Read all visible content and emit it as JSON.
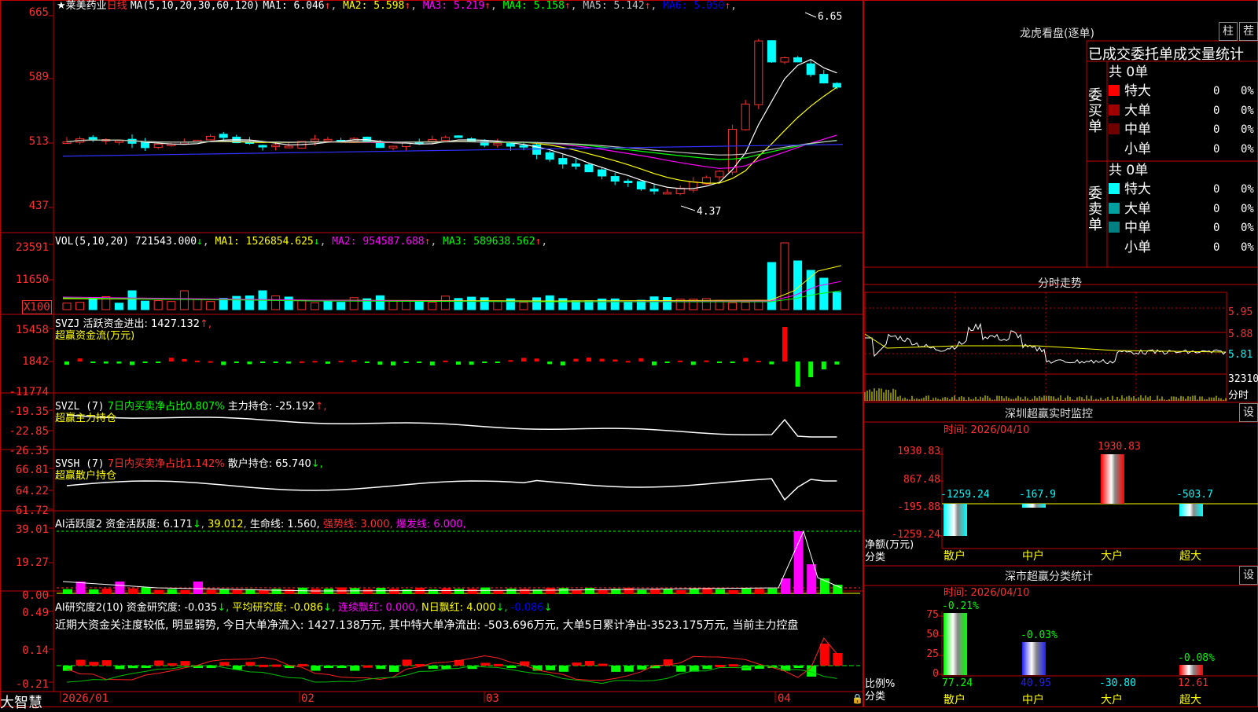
{
  "stock": {
    "star": "★",
    "name": "莱美药业",
    "period": "日线",
    "ma_params": "MA(5,10,20,30,60,120)",
    "ma_values": [
      {
        "label": "MA1: 6.046",
        "arrow": "↑",
        "color": "#ffffff"
      },
      {
        "label": "MA2: 5.598",
        "arrow": "↑",
        "color": "#ffff00"
      },
      {
        "label": "MA3: 5.219",
        "arrow": "↑",
        "color": "#ff00ff"
      },
      {
        "label": "MA4: 5.158",
        "arrow": "↑",
        "color": "#00ff00"
      },
      {
        "label": "MA5: 5.142",
        "arrow": "↑",
        "color": "#c0c0c0"
      },
      {
        "label": "MA6: 5.050",
        "arrow": "↑",
        "color": "#0000ff"
      }
    ],
    "high_marker": "6.65",
    "low_marker": "4.37",
    "price_axis": [
      "665",
      "589",
      "513",
      "437"
    ]
  },
  "panels": {
    "vol": {
      "title": "VOL(5,10,20)",
      "value": "721543.000",
      "arrow": "↓",
      "ma": [
        {
          "label": "MA1: 1526854.625",
          "arrow": "↓",
          "color": "#ffff00"
        },
        {
          "label": "MA2: 954587.688",
          "arrow": "↑",
          "color": "#ff00ff"
        },
        {
          "label": "MA3: 589638.562",
          "arrow": "↑",
          "color": "#00ff00"
        }
      ],
      "axis": [
        "23591",
        "11650",
        "X100"
      ]
    },
    "svzj": {
      "title": "SVZJ",
      "text": "活跃资金进出: 1427.132",
      "arrow": "↑,",
      "subtitle": "超赢资金流(万元)",
      "axis": [
        "15458",
        "1842",
        "-11774"
      ]
    },
    "svzl": {
      "title": "SVZL (7)",
      "text_green": "7日内买卖净占比0.807%",
      "text": "主力持仓: -25.192",
      "arrow": "↑,",
      "subtitle": "超赢主力持仓",
      "axis": [
        "-19.35",
        "-22.85",
        "-26.35"
      ]
    },
    "svsh": {
      "title": "SVSH (7)",
      "text_red": "7日内买卖净占比1.142%",
      "text": "散户持仓: 65.740",
      "arrow": "↓,",
      "subtitle": "超赢散户持仓",
      "axis": [
        "66.81",
        "64.22",
        "61.72"
      ]
    },
    "ai1": {
      "title": "AI活跃度2",
      "text1": "资金活跃度: 6.171",
      "arrow1": "↓",
      "text2": "39.012",
      "text3": "生命线: 1.560,",
      "text4": "强势线: 3.000,",
      "text5": "爆发线: 6.000,",
      "axis": [
        "39.01",
        "19.27",
        "0.00"
      ]
    },
    "ai2": {
      "title": "AI研究度2(10)",
      "text1": "资金研究度: -0.035",
      "arrow1": "↓,",
      "text2": "平均研究度: -0.086",
      "arrow2": "↓,",
      "text3": "连续飘红: 0.000,",
      "text4": "N日飘红: 4.000",
      "arrow4": "↓,",
      "text5": "-0.086",
      "arrow5": "↓",
      "comment": "近期大资金关注度较低, 明显弱势, 今日大单净流入: 1427.138万元, 其中特大单净流出: -503.696万元, 大单5日累计净出-3523.175万元, 当前主力控盘",
      "axis": [
        "0.49",
        "0.14",
        "-0.21"
      ]
    }
  },
  "time_axis": [
    "2026/01",
    "02",
    "03",
    "04"
  ],
  "brand": "大智慧",
  "right": {
    "longhu_title": "龙虎看盘(逐单)",
    "btn_zhu": "柱",
    "btn_zhe": "茬",
    "stat_title": "已成交委托单成交量统计",
    "buy_label": "委买单",
    "sell_label": "委卖单",
    "buy_total": "共 0单",
    "sell_total": "共 0单",
    "buy_rows": [
      {
        "label": "特大",
        "color": "#ff0000",
        "count": "0",
        "pct": "0%"
      },
      {
        "label": "大单",
        "color": "#a00000",
        "count": "0",
        "pct": "0%"
      },
      {
        "label": "中单",
        "color": "#700000",
        "count": "0",
        "pct": "0%"
      },
      {
        "label": "小单",
        "color": "#000000",
        "count": "0",
        "pct": "0%"
      }
    ],
    "sell_rows": [
      {
        "label": "特大",
        "color": "#00ffff",
        "count": "0",
        "pct": "0%"
      },
      {
        "label": "大单",
        "color": "#00a0a0",
        "count": "0",
        "pct": "0%"
      },
      {
        "label": "中单",
        "color": "#008080",
        "count": "0",
        "pct": "0%"
      },
      {
        "label": "小单",
        "color": "#000000",
        "count": "0",
        "pct": "0%"
      }
    ],
    "fenshi_title": "分时走势",
    "fenshi_axis": [
      "5.95",
      "5.88",
      "5.81"
    ],
    "fenshi_vol": "32310",
    "fenshi_label": "分时",
    "monitor": {
      "title": "深圳超赢实时监控",
      "btn": "设",
      "time": "时间: 2026/04/10",
      "axis": [
        "1930.83",
        "867.48",
        "-195.88",
        "-1259.24"
      ],
      "ylabel1": "净额(万元)",
      "ylabel2": "分类",
      "bars": [
        {
          "cat": "散户",
          "value": "-1259.24"
        },
        {
          "cat": "中户",
          "value": "-167.9"
        },
        {
          "cat": "大户",
          "value": "1930.83"
        },
        {
          "cat": "超大",
          "value": "-503.7"
        }
      ]
    },
    "classify": {
      "title": "深市超赢分类统计",
      "btn": "设",
      "time": "时间: 2026/04/10",
      "axis": [
        "75",
        "50",
        "25",
        "0"
      ],
      "ylabel1": "比例%",
      "ylabel2": "分类",
      "bars": [
        {
          "cat": "散户",
          "top": "-0.21%",
          "bottom": "77.24"
        },
        {
          "cat": "中户",
          "top": "-0.03%",
          "bottom": "40.95"
        },
        {
          "cat": "大户",
          "top": "",
          "bottom": "-30.80"
        },
        {
          "cat": "超大",
          "top": "-0.08%",
          "bottom": "12.61"
        }
      ]
    }
  },
  "colors": {
    "up": "#ff3030",
    "down": "#00ffff",
    "border": "#c00000"
  }
}
